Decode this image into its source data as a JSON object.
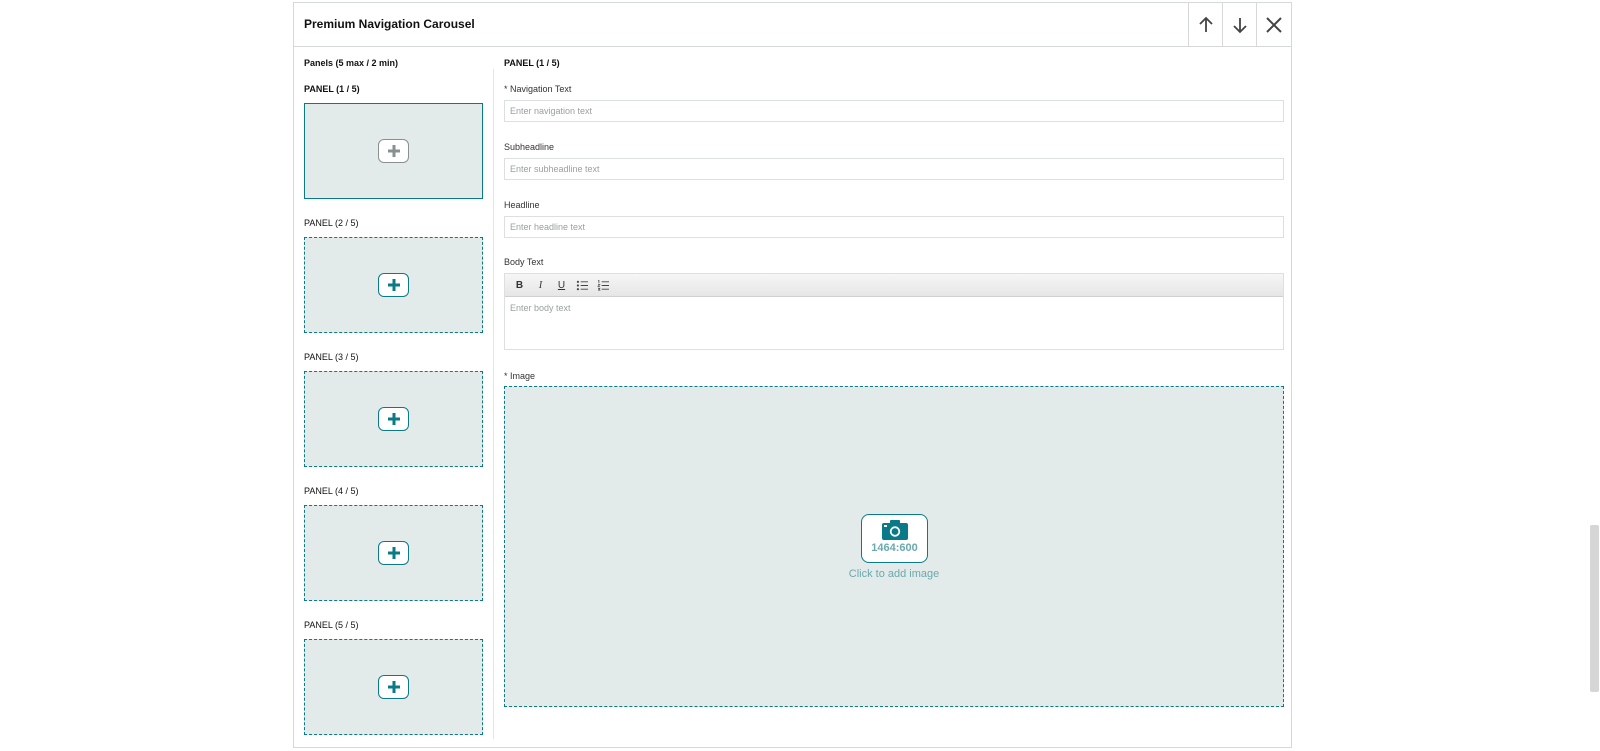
{
  "module": {
    "title": "Premium Navigation Carousel",
    "buttons": [
      "move-up",
      "move-down",
      "close"
    ]
  },
  "panels": {
    "heading": "Panels (5 max / 2 min)",
    "items": [
      {
        "label": "PANEL (1 / 5)",
        "active": true
      },
      {
        "label": "PANEL (2 / 5)",
        "active": false
      },
      {
        "label": "PANEL (3 / 5)",
        "active": false
      },
      {
        "label": "PANEL (4 / 5)",
        "active": false
      },
      {
        "label": "PANEL (5 / 5)",
        "active": false
      }
    ]
  },
  "editor": {
    "heading": "PANEL (1 / 5)",
    "navigation": {
      "label": "* Navigation Text",
      "placeholder": "Enter navigation text"
    },
    "subheadline": {
      "label": "Subheadline",
      "placeholder": "Enter subheadline text"
    },
    "headline": {
      "label": "Headline",
      "placeholder": "Enter headline text"
    },
    "body": {
      "label": "Body Text",
      "placeholder": "Enter body text",
      "toolbar": [
        "B",
        "I",
        "U"
      ]
    },
    "image": {
      "label": "* Image",
      "ratio": "1464:600",
      "cta": "Click to add image"
    }
  },
  "colors": {
    "accent": "#0a7a88",
    "placeholder_bg": "#e3eaea"
  }
}
